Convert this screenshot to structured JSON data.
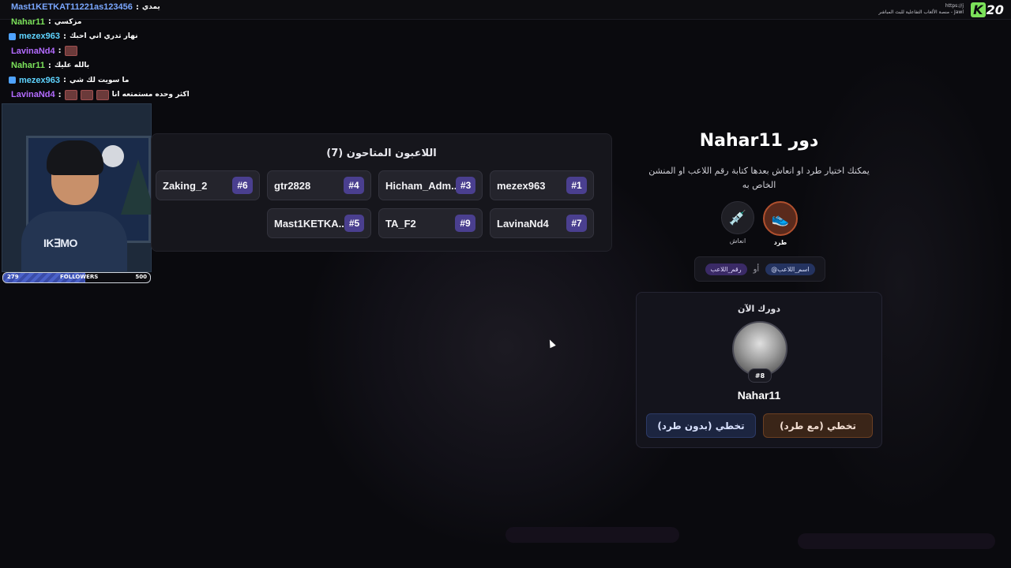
{
  "brand": {
    "url_text": "https://j",
    "tagline": "Jawl - منصة الألعاب التفاعلية للبث المباشر",
    "logo_k": "K",
    "logo_num": "20"
  },
  "chat": [
    {
      "user": "Mast1KETKAT11221as123456",
      "user_color": "#7aa7ff",
      "message": "يمدي",
      "badge": false,
      "emotes": 0
    },
    {
      "user": "Nahar11",
      "user_color": "#7be15a",
      "message": "مزكسي",
      "badge": false,
      "emotes": 0
    },
    {
      "user": "mezex963",
      "user_color": "#5fd4ff",
      "message": "نهار تدري اني احبك",
      "badge": true,
      "emotes": 0
    },
    {
      "user": "LavinaNd4",
      "user_color": "#b36bff",
      "message": "",
      "badge": false,
      "emotes": 1
    },
    {
      "user": "Nahar11",
      "user_color": "#7be15a",
      "message": "بالله عليك",
      "badge": false,
      "emotes": 0
    },
    {
      "user": "mezex963",
      "user_color": "#5fd4ff",
      "message": "ما سويت لك شي",
      "badge": true,
      "emotes": 0
    },
    {
      "user": "LavinaNd4",
      "user_color": "#b36bff",
      "message": "اكثر وحده مستمتعه انا",
      "badge": false,
      "emotes": 3
    }
  ],
  "webcam": {
    "shirt_logo": "IK∃MO"
  },
  "followers": {
    "current": "279",
    "label": "FOLLOWERS",
    "goal": "500",
    "progress": 0.558
  },
  "players_panel": {
    "title": "اللاعبون المتاحون (7)",
    "players": [
      {
        "name": "mezex963",
        "num": "#1"
      },
      {
        "name": "Hicham_Adm...",
        "num": "#3"
      },
      {
        "name": "gtr2828",
        "num": "#4"
      },
      {
        "name": "Zaking_2",
        "num": "#6"
      },
      {
        "name": "LavinaNd4",
        "num": "#7"
      },
      {
        "name": "TA_F2",
        "num": "#9"
      },
      {
        "name": "Mast1KETKA...",
        "num": "#5"
      }
    ]
  },
  "turn": {
    "title": "دور Nahar11",
    "description": "يمكنك اختيار طرد او انعاش بعدها كتابة رقم اللاعب او المنشن الخاص به",
    "actions": {
      "kick_label": "طرد",
      "revive_label": "انعاش",
      "kick_icon": "sneaker-icon",
      "revive_icon": "syringe-icon"
    },
    "hint": {
      "name_chip": "@اسم_اللاعب",
      "or": "أو",
      "num_chip": "رقم_اللاعب"
    }
  },
  "current_turn": {
    "label": "دورك الآن",
    "num": "#8",
    "name": "Nahar11",
    "skip_kick": "تخطي (مع طرد)",
    "skip_no_kick": "تخطي (بدون طرد)"
  }
}
